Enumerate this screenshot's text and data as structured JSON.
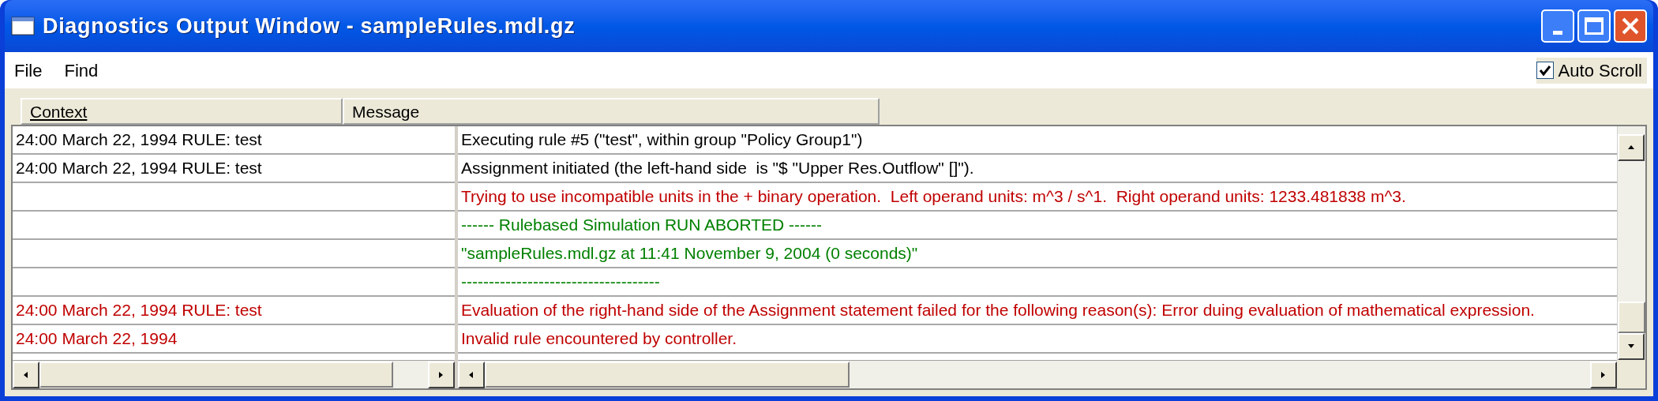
{
  "window": {
    "title": "Diagnostics Output Window - sampleRules.mdl.gz"
  },
  "menu": [
    {
      "label": "File"
    },
    {
      "label": "Find"
    }
  ],
  "auto_scroll": {
    "label": "Auto Scroll",
    "checked": true
  },
  "table": {
    "columns": [
      {
        "label": "Context",
        "sorted": true
      },
      {
        "label": "Message",
        "sorted": false
      }
    ],
    "rows": [
      {
        "context": {
          "text": "24:00 March 22, 1994 RULE: test",
          "color": "#000000"
        },
        "message": {
          "text": "Executing rule #5 (\"test\", within group \"Policy Group1\")",
          "color": "#000000"
        }
      },
      {
        "context": {
          "text": "24:00 March 22, 1994 RULE: test",
          "color": "#000000"
        },
        "message": {
          "text": "Assignment initiated (the left-hand side  is \"$ \"Upper Res.Outflow\" []\").",
          "color": "#000000"
        }
      },
      {
        "message": {
          "text": "Trying to use incompatible units in the + binary operation.  Left operand units: m^3 / s^1.  Right operand units: 1233.481838 m^3.",
          "color": "#c00000"
        }
      },
      {
        "message": {
          "text": "------ Rulebased Simulation RUN ABORTED ------",
          "color": "#008000"
        }
      },
      {
        "message": {
          "text": "\"sampleRules.mdl.gz at 11:41 November 9, 2004 (0 seconds)\"",
          "color": "#008000"
        }
      },
      {
        "message": {
          "text": "------------------------------------",
          "color": "#008000"
        }
      },
      {
        "context": {
          "text": "24:00 March 22, 1994 RULE: test",
          "color": "#c00000"
        },
        "message": {
          "text": "Evaluation of the right-hand side of the Assignment statement failed for the following reason(s): Error duing evaluation of mathematical expression.",
          "color": "#c00000"
        }
      },
      {
        "context": {
          "text": "24:00 March 22, 1994",
          "color": "#c00000"
        },
        "message": {
          "text": "Invalid rule encountered by controller.",
          "color": "#c00000"
        }
      }
    ]
  }
}
